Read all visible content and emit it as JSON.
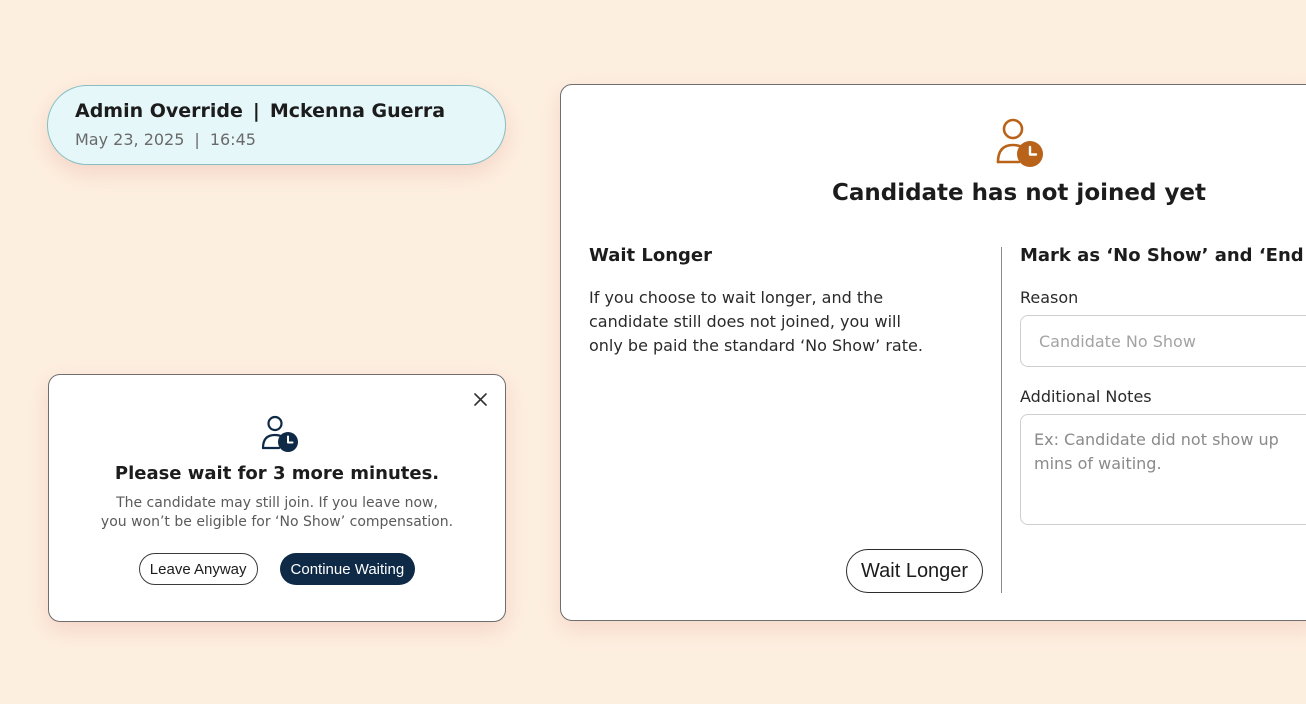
{
  "override": {
    "label": "Admin Override",
    "separator": "|",
    "name": "Mckenna Guerra",
    "date": "May 23, 2025",
    "time": "16:45"
  },
  "wait_modal": {
    "title": "Please wait for 3 more minutes.",
    "desc_line1": "The candidate may still join. If you leave now,",
    "desc_line2": "you won’t be eligible for ‘No Show’ compensation.",
    "leave_label": "Leave Anyway",
    "continue_label": "Continue Waiting",
    "close_icon": "close-icon",
    "icon": "user-clock-icon"
  },
  "big_modal": {
    "icon": "user-clock-icon",
    "title": "Candidate has not joined yet",
    "left": {
      "heading": "Wait Longer",
      "line1": "If you choose to wait longer, and the",
      "line2": "candidate still does not joined, you will",
      "line3": "only be paid the standard ‘No Show’ rate.",
      "button_label": "Wait Longer"
    },
    "right": {
      "heading": "Mark as ‘No Show’ and ‘End C",
      "reason_label": "Reason",
      "reason_placeholder": "Candidate No Show",
      "notes_label": "Additional Notes",
      "notes_line1": "Ex: Candidate did not show up",
      "notes_line2": "mins of waiting."
    }
  },
  "colors": {
    "background": "#fdefe0",
    "primary_button": "#0e2a47",
    "icon_orange": "#b8621a",
    "pill_bg": "#e6f7f9"
  }
}
